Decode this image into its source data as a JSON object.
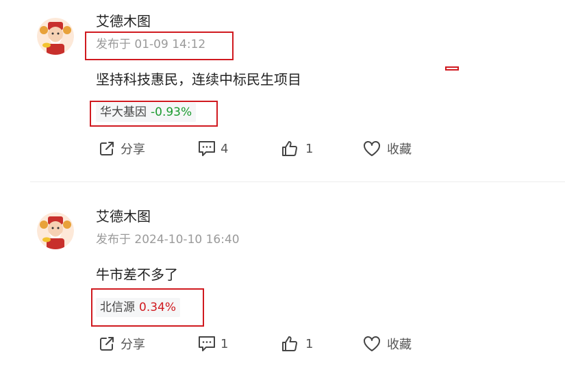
{
  "colors": {
    "down": "#1a9a2e",
    "up": "#d0191f",
    "highlight": "#d0191f"
  },
  "posts": [
    {
      "author": "艾德木图",
      "time": "发布于 01-09 14:12",
      "content": "坚持科技惠民，连续中标民生项目",
      "stock": {
        "name": "华大基因",
        "change": "-0.93%"
      },
      "actions": {
        "share_label": "分享",
        "comment_count": "4",
        "like_count": "1",
        "favorite_label": "收藏"
      }
    },
    {
      "author": "艾德木图",
      "time": "发布于 2024-10-10 16:40",
      "content": "牛市差不多了",
      "stock": {
        "name": "北信源",
        "change": "0.34%"
      },
      "actions": {
        "share_label": "分享",
        "comment_count": "1",
        "like_count": "1",
        "favorite_label": "收藏"
      }
    }
  ],
  "icons": {
    "avatar": "caishen-avatar-icon",
    "share": "share-icon",
    "comment": "comment-icon",
    "like": "thumbs-up-icon",
    "favorite": "heart-icon"
  }
}
